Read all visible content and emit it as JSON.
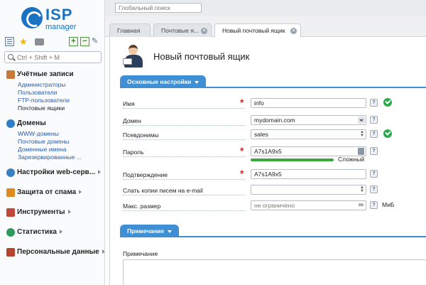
{
  "app": {
    "logo_isp": "ISP",
    "logo_manager": "manager",
    "global_search_placeholder": "Глобальный поиск"
  },
  "sidebar": {
    "search_placeholder": "Ctrl + Shift + M",
    "groups": [
      {
        "title": "Учётные записи",
        "icon": "users-icon",
        "color": "#c87a3a",
        "items": [
          "Администраторы",
          "Пользователи",
          "FTP-пользователи",
          "Почтовые ящики"
        ],
        "active": 3
      },
      {
        "title": "Домены",
        "icon": "globe-icon",
        "color": "#2f7fc8",
        "items": [
          "WWW-домены",
          "Почтовые домены",
          "Доменные имена",
          "Зарезервированные ..."
        ]
      },
      {
        "title": "Настройки web-серв...",
        "icon": "web-settings-icon",
        "color": "#3a7fc0"
      },
      {
        "title": "Защита от спама",
        "icon": "shield-icon",
        "color": "#e08a1e"
      },
      {
        "title": "Инструменты",
        "icon": "tools-icon",
        "color": "#c0473a"
      },
      {
        "title": "Статистика",
        "icon": "stats-icon",
        "color": "#2f9a5a"
      },
      {
        "title": "Персональные данные",
        "icon": "books-icon",
        "color": "#b5452f"
      }
    ]
  },
  "tabs": [
    {
      "label": "Главная",
      "closable": false
    },
    {
      "label": "Почтовые я...",
      "closable": true
    },
    {
      "label": "Новый почтовый ящик",
      "closable": true,
      "active": true
    }
  ],
  "page": {
    "title": "Новый почтовый ящик",
    "section_main": "Основные настройки",
    "section_note": "Примечание",
    "note_label": "Примечание"
  },
  "form": {
    "name": {
      "label": "Имя",
      "value": "info",
      "required": true,
      "valid": true
    },
    "domain": {
      "label": "Домен",
      "value": "mydomain.com"
    },
    "aliases": {
      "label": "Псевдонимы",
      "value": "sales",
      "valid": true
    },
    "password": {
      "label": "Пароль",
      "value": "A7s1A9x5",
      "required": true,
      "strength_label": "Сложный",
      "strength": 1.0
    },
    "confirm": {
      "label": "Подтверждение",
      "value": "A7s1A9x5",
      "required": true
    },
    "copies": {
      "label": "Слать копии писем на e-mail",
      "value": ""
    },
    "max_size": {
      "label": "Макс. размер",
      "placeholder": "не ограничено",
      "unit": "МиБ"
    }
  },
  "colors": {
    "accent": "#3f8fd4",
    "ok": "#2da84a",
    "required": "#e22222",
    "strength": "#3aa83c"
  }
}
